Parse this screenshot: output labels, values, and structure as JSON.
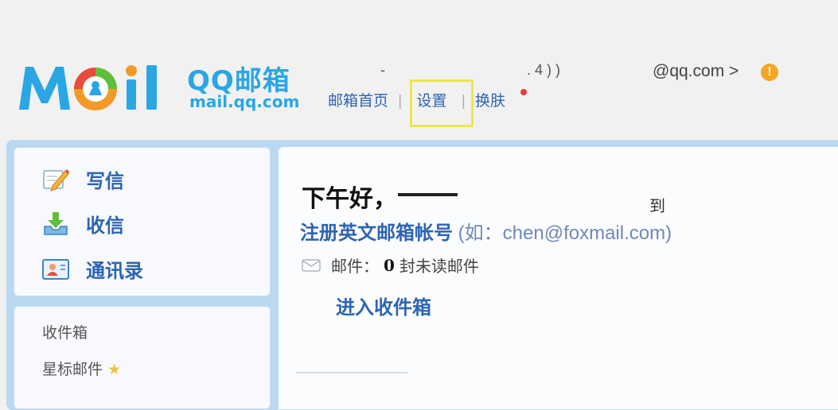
{
  "brand": {
    "logo_text": "MOil",
    "name": "QQ邮箱",
    "url": "mail.qq.com"
  },
  "topnav": {
    "home": "邮箱首页",
    "separator": "|",
    "settings": "设置",
    "skin": "换肤"
  },
  "account": {
    "fragment1": "-",
    "fragment2": ". 4 ) )",
    "email": "@qq.com >",
    "alert": "!"
  },
  "actions": {
    "write": "写信",
    "receive": "收信",
    "contacts": "通讯录"
  },
  "folders": {
    "inbox": "收件箱",
    "starred": "星标邮件",
    "star_glyph": "★"
  },
  "main": {
    "greeting": "下午好，",
    "greeting_tail": "到",
    "register_link": "注册英文邮箱帐号",
    "register_hint": " (如：chen@foxmail.com)",
    "mail_label": "邮件：",
    "mail_count": "0",
    "mail_unread": "封未读邮件",
    "inbox_link": "进入收件箱"
  },
  "colors": {
    "link": "#2d64b3",
    "brand": "#2aa6e4",
    "frame": "#b9d9f3",
    "highlight": "#ece64c"
  }
}
